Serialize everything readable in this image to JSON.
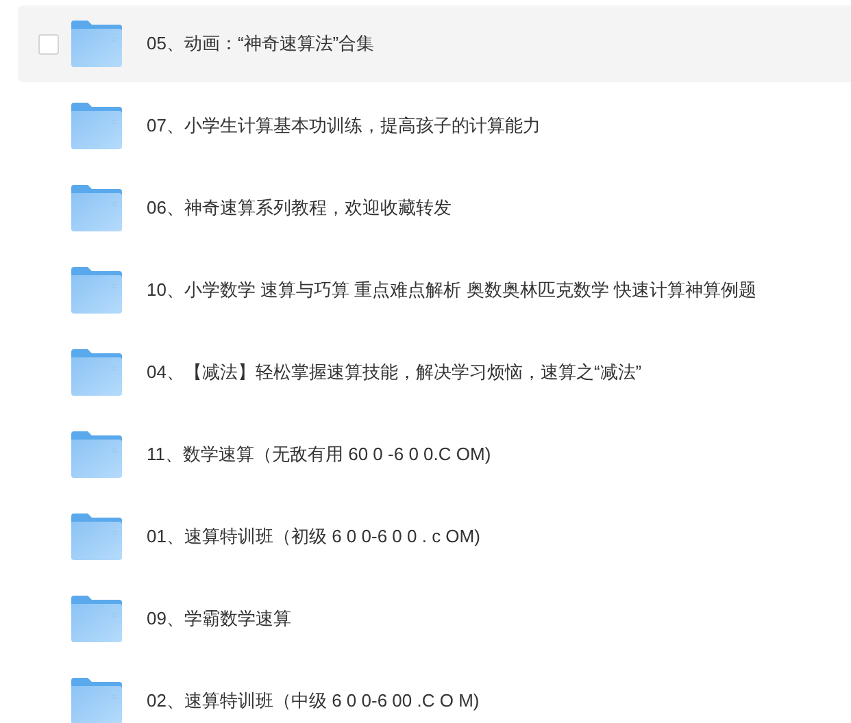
{
  "files": [
    {
      "name": "05、动画：“神奇速算法”合集",
      "hovered": true,
      "checked": false
    },
    {
      "name": "07、小学生计算基本功训练，提高孩子的计算能力",
      "hovered": false,
      "checked": false
    },
    {
      "name": "06、神奇速算系列教程，欢迎收藏转发",
      "hovered": false,
      "checked": false
    },
    {
      "name": "10、小学数学 速算与巧算 重点难点解析 奥数奥林匹克数学 快速计算神算例题",
      "hovered": false,
      "checked": false
    },
    {
      "name": "04、【减法】轻松掌握速算技能，解决学习烦恼，速算之“减法”",
      "hovered": false,
      "checked": false
    },
    {
      "name": "11、数学速算（无敌有用 60 0 -6 0 0.C OM)",
      "hovered": false,
      "checked": false
    },
    {
      "name": "01、速算特训班（初级 6 0 0-6 0 0 . c OM)",
      "hovered": false,
      "checked": false
    },
    {
      "name": "09、学霸数学速算",
      "hovered": false,
      "checked": false
    },
    {
      "name": "02、速算特训班（中级 6 0 0-6 00 .C O M)",
      "hovered": false,
      "checked": false
    }
  ]
}
